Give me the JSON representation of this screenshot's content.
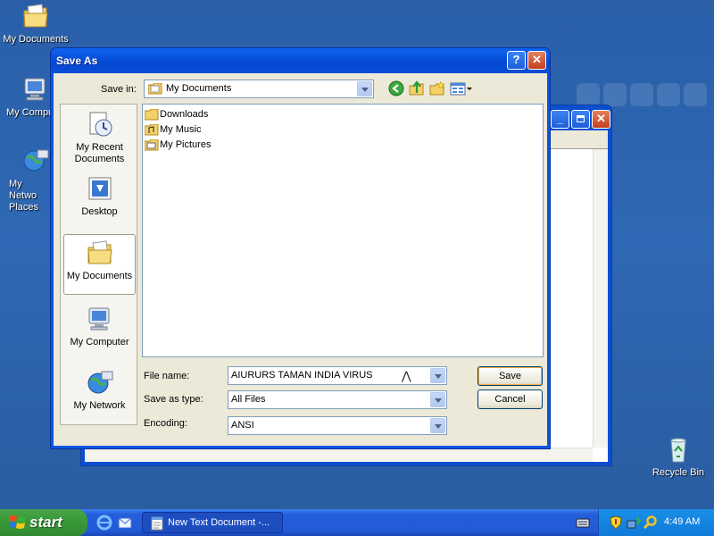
{
  "desktop": {
    "icons": [
      {
        "label": "My Documents"
      },
      {
        "label": "My Compu"
      },
      {
        "label": "My Netwo Places"
      },
      {
        "label": "Recycle Bin"
      }
    ]
  },
  "dialog": {
    "title": "Save As",
    "save_in_label": "Save in:",
    "save_in_value": "My Documents",
    "places": [
      {
        "label": "My Recent Documents"
      },
      {
        "label": "Desktop"
      },
      {
        "label": "My Documents"
      },
      {
        "label": "My Computer"
      },
      {
        "label": "My Network"
      }
    ],
    "files": [
      {
        "name": "Downloads"
      },
      {
        "name": "My Music"
      },
      {
        "name": "My Pictures"
      }
    ],
    "file_name_label": "File name:",
    "file_name_value": "AIURURS TAMAN INDIA VIRUS",
    "save_as_type_label": "Save as type:",
    "save_as_type_value": "All Files",
    "encoding_label": "Encoding:",
    "encoding_value": "ANSI",
    "save_button": "Save",
    "cancel_button": "Cancel"
  },
  "taskbar": {
    "start_label": "start",
    "task_label": "New Text Document -...",
    "clock": "4:49 AM"
  },
  "colors": {
    "desktop": "#2f68b4",
    "title_bar": "#0548d2",
    "dialog_bg": "#ece9d8",
    "start_green": "#3a9a3a"
  }
}
